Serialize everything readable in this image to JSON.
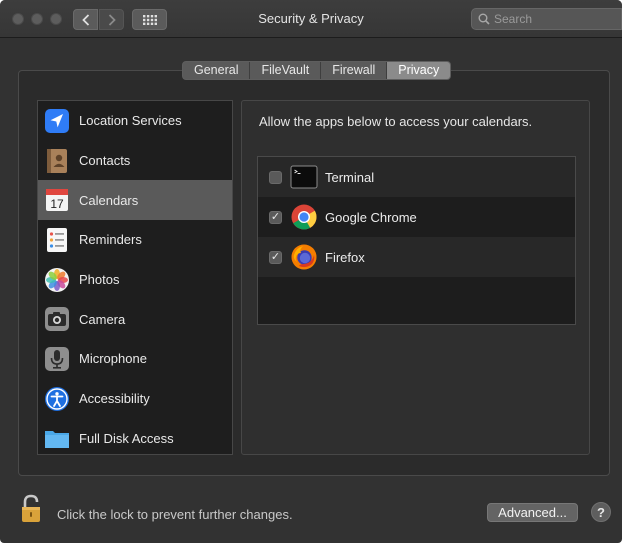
{
  "window": {
    "title": "Security & Privacy"
  },
  "toolbar": {
    "search_placeholder": "Search"
  },
  "tabs": [
    {
      "label": "General"
    },
    {
      "label": "FileVault"
    },
    {
      "label": "Firewall"
    },
    {
      "label": "Privacy",
      "active": true
    }
  ],
  "sidebar": {
    "items": [
      {
        "label": "Location Services",
        "icon": "location-arrow-icon"
      },
      {
        "label": "Contacts",
        "icon": "contacts-book-icon"
      },
      {
        "label": "Calendars",
        "icon": "calendar-icon",
        "selected": true,
        "calendar_day": "17"
      },
      {
        "label": "Reminders",
        "icon": "reminders-list-icon"
      },
      {
        "label": "Photos",
        "icon": "photos-flower-icon"
      },
      {
        "label": "Camera",
        "icon": "camera-icon"
      },
      {
        "label": "Microphone",
        "icon": "microphone-icon"
      },
      {
        "label": "Accessibility",
        "icon": "accessibility-icon"
      },
      {
        "label": "Full Disk Access",
        "icon": "folder-icon"
      }
    ]
  },
  "privacy": {
    "description": "Allow the apps below to access your calendars.",
    "apps": [
      {
        "name": "Terminal",
        "checked": false,
        "icon": "terminal-icon"
      },
      {
        "name": "Google Chrome",
        "checked": true,
        "icon": "chrome-icon"
      },
      {
        "name": "Firefox",
        "checked": true,
        "icon": "firefox-icon"
      }
    ]
  },
  "footer": {
    "lock_text": "Click the lock to prevent further changes.",
    "advanced_label": "Advanced...",
    "help_label": "?"
  },
  "colors": {
    "window_bg": "#323232",
    "sidebar_selected": "#5a5a5a",
    "lock_gold": "#d9a23a"
  }
}
